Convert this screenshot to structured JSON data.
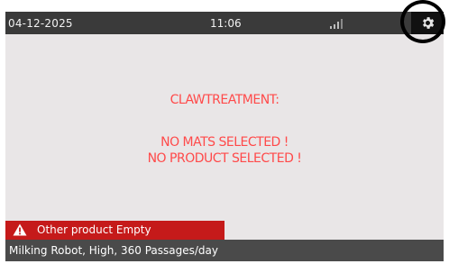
{
  "status_bar": {
    "date": "04-12-2025",
    "time": "11:06",
    "signal_icon": "signal-strength-icon",
    "settings_icon": "gear-icon"
  },
  "main": {
    "title": "CLAWTREATMENT:",
    "message_1": "NO MATS SELECTED !",
    "message_2": "NO PRODUCT SELECTED !"
  },
  "alert": {
    "icon": "warning-triangle-icon",
    "text": "Other product Empty"
  },
  "footer": {
    "text": "Milking Robot, High, 360 Passages/day"
  },
  "colors": {
    "status_bar": "#3a3a3a",
    "screen_background": "#e9e6e7",
    "message_text": "#ff4a4a",
    "alert_background": "#c51a1a",
    "footer_background": "#4a4a4a"
  }
}
